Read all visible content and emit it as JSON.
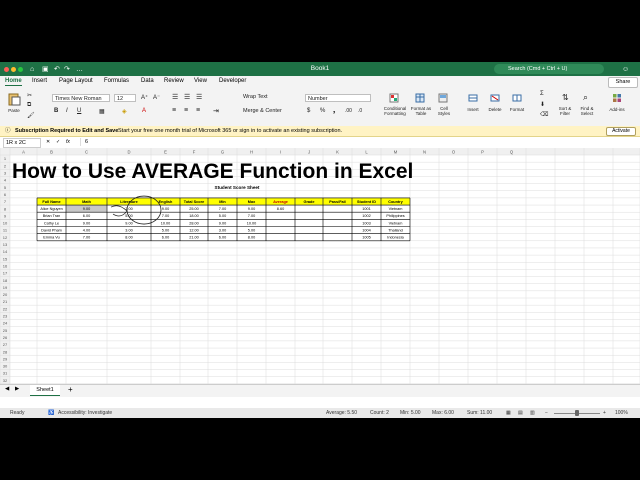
{
  "window": {
    "title": "Book1",
    "search_placeholder": "Search (Cmd + Ctrl + U)",
    "share_label": "Share"
  },
  "tabs": [
    "Home",
    "Insert",
    "Page Layout",
    "Formulas",
    "Data",
    "Review",
    "View",
    "Developer"
  ],
  "ribbon": {
    "paste": "Paste",
    "font_name": "Times New Roman",
    "font_size": "12",
    "wrap_text": "Wrap Text",
    "merge_center": "Merge & Center",
    "number_format": "Number",
    "groups": [
      "Conditional Formatting",
      "Format as Table",
      "Cell Styles",
      "Insert",
      "Delete",
      "Format",
      "Sort & Filter",
      "Find & Select",
      "Add-ins"
    ]
  },
  "message_bar": {
    "bold": "Subscription Required to Edit and Save",
    "text": "Start your free one month trial of Microsoft 365 or sign in to activate an existing subscription.",
    "button": "Activate"
  },
  "formula_bar": {
    "name_box": "1R x 2C",
    "value": "6"
  },
  "columns": [
    "A",
    "B",
    "C",
    "D",
    "E",
    "F",
    "G",
    "H",
    "I",
    "J",
    "K",
    "L",
    "M",
    "N",
    "O",
    "P",
    "Q"
  ],
  "heading_text": "How to Use AVERAGE Function in Excel",
  "table": {
    "title": "Student Score Sheet",
    "headers": [
      "Full Name",
      "Math",
      "Literature",
      "English",
      "Total Score",
      "Min",
      "Max",
      "Average",
      "Grade",
      "Pass/Fail",
      "Student ID",
      "Country"
    ],
    "rows": [
      [
        "Alice Nguyen",
        "9.00",
        "7.00",
        "9.00",
        "25.00",
        "7.00",
        "9.00",
        "8.60",
        "",
        "",
        "1001",
        "Vietnam"
      ],
      [
        "Brian Tran",
        "6.00",
        "5.00",
        "7.00",
        "18.00",
        "5.00",
        "7.00",
        "",
        "",
        "",
        "1002",
        "Philippines"
      ],
      [
        "Cathy Le",
        "9.00",
        "9.00",
        "10.00",
        "28.00",
        "9.00",
        "10.00",
        "",
        "",
        "",
        "1003",
        "Vietnam"
      ],
      [
        "David Pham",
        "4.00",
        "3.00",
        "5.00",
        "12.00",
        "3.00",
        "5.00",
        "",
        "",
        "",
        "1004",
        "Thailand"
      ],
      [
        "Emma Vu",
        "7.00",
        "8.00",
        "6.00",
        "21.00",
        "6.00",
        "8.00",
        "",
        "",
        "",
        "1005",
        "Indonesia"
      ]
    ]
  },
  "sheet_tab": "Sheet1",
  "status": {
    "ready": "Ready",
    "accessibility": "Accessibility: Investigate",
    "average": "Average: 5.50",
    "count": "Count: 2",
    "min": "Min: 5.00",
    "max": "Max: 6.00",
    "sum": "Sum: 11.00",
    "zoom": "100%"
  },
  "colors": {
    "excel_green": "#1e7145",
    "header_yellow": "#ffff00",
    "selection_gray": "#c8c8c8"
  }
}
